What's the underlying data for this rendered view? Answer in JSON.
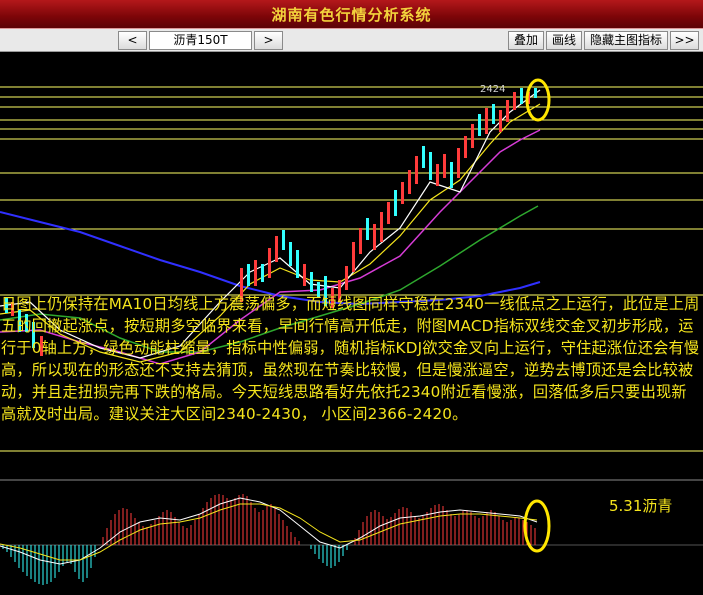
{
  "window": {
    "title": "湖南有色行情分析系统"
  },
  "toolbar": {
    "prev_label": "<",
    "symbol": "沥青150T",
    "next_label": ">",
    "overlay_label": "叠加",
    "line_label": "画线",
    "hide_main_indicator_label": "隐藏主图指标",
    "more_label": ">>"
  },
  "chart": {
    "price_label": "2424",
    "colors": {
      "up": "#ff3b3b",
      "down": "#33ffff",
      "ma_short": "#ffffff",
      "ma_mid": "#f5e51d",
      "ma_long": "#d63cd6",
      "ma_green": "#2ea82e",
      "ma_blue": "#3030ff",
      "hline": "#ffff66",
      "highlight": "#ffe600"
    }
  },
  "commentary": {
    "text": "日图上仍保持在MA10日均线上方震荡偏多，而短线图同样守稳在2340一线低点之上运行，此位是上周五的回撤起涨点，按短期多空临界来看，早间行情高开低走，附图MACD指标双线交金叉初步形成，运行于0轴上方，绿色动能柱缩量，指标中性偏弱，随机指标KDJ欲交金叉向上运行，守住起涨位还会有慢高，所以现在的形态还不支持去猜顶，虽然现在节奏比较慢，但是慢涨逼空，逆势去博顶还是会比较被动，并且走扭损完再下跌的格局。今天短线思路看好先依托2340附近看慢涨，回落低多后只要出现新高就及时出局。建议关注大区间2340-2430， 小区间2366-2420。"
  },
  "macd": {
    "label": "5.31沥青"
  }
}
